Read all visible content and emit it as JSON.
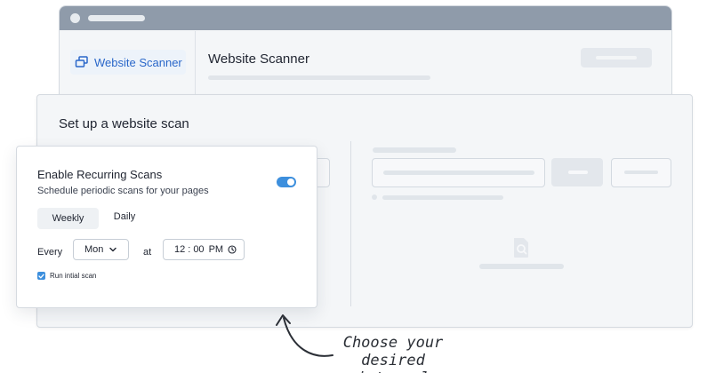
{
  "browser": {
    "nav_item_label": "Website Scanner",
    "page_title": "Website Scanner"
  },
  "scan_panel": {
    "title": "Set up a website scan"
  },
  "recurring_card": {
    "title": "Enable Recurring Scans",
    "subtitle": "Schedule periodic scans for your pages",
    "toggle_on": true,
    "tabs": [
      {
        "label": "Weekly",
        "selected": true
      },
      {
        "label": "Daily",
        "selected": false
      }
    ],
    "every_label": "Every",
    "day_value": "Mon",
    "at_label": "at",
    "time": {
      "hour": "12",
      "separator": ":",
      "minute": "00",
      "period": "PM"
    },
    "initial_scan_label": "Run intial scan",
    "initial_scan_checked": true
  },
  "annotation": {
    "line1": "Choose your",
    "line2": "desired interval"
  },
  "colors": {
    "accent": "#3d8fdd",
    "nav_text": "#2a67c9",
    "browser_bar": "#8f9baa"
  }
}
